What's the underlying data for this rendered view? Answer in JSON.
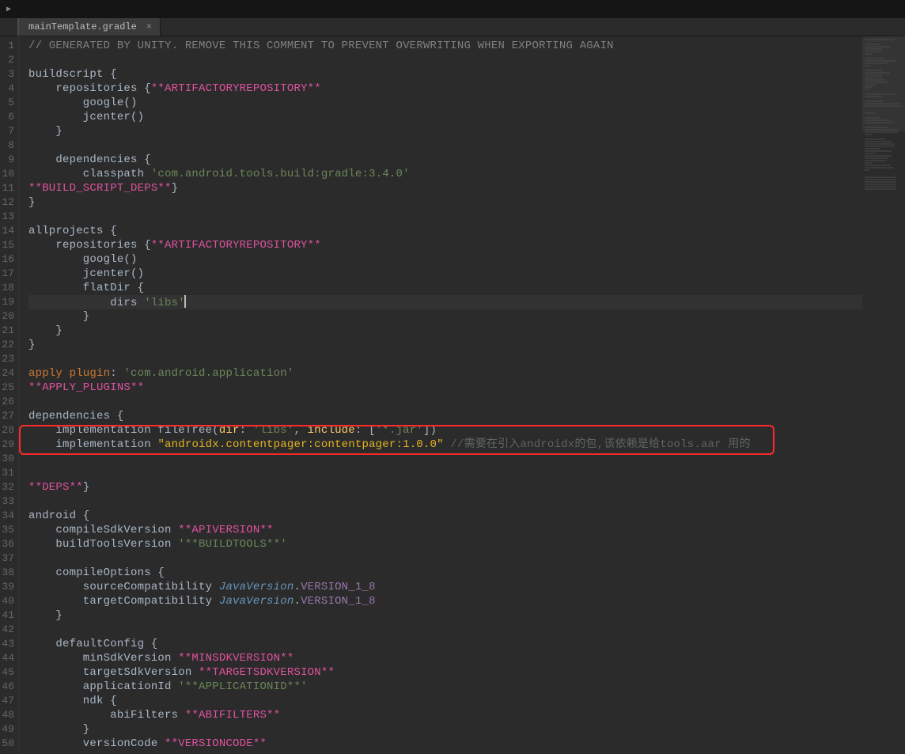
{
  "tab": {
    "filename": "mainTemplate.gradle",
    "close_glyph": "×"
  },
  "titlebar": {
    "play_glyph": "▶"
  },
  "gutter": {
    "start": 1,
    "end": 50
  },
  "code": {
    "l1": {
      "a": "// GENERATED BY UNITY. REMOVE THIS COMMENT TO PREVENT OVERWRITING WHEN EXPORTING AGAIN"
    },
    "l3": {
      "a": "buildscript",
      "b": " {"
    },
    "l4": {
      "a": "    repositories",
      "b": " {",
      "c": "**ARTIFACTORYREPOSITORY**"
    },
    "l5": {
      "a": "        google",
      "b": "()"
    },
    "l6": {
      "a": "        jcenter",
      "b": "()"
    },
    "l7": {
      "a": "    }"
    },
    "l9": {
      "a": "    dependencies",
      "b": " {"
    },
    "l10": {
      "a": "        classpath ",
      "b": "'com.android.tools.build:gradle:3.4.0'"
    },
    "l11": {
      "a": "**BUILD_SCRIPT_DEPS**",
      "b": "}"
    },
    "l12": {
      "a": "}"
    },
    "l14": {
      "a": "allprojects",
      "b": " {"
    },
    "l15": {
      "a": "    repositories",
      "b": " {",
      "c": "**ARTIFACTORYREPOSITORY**"
    },
    "l16": {
      "a": "        google",
      "b": "()"
    },
    "l17": {
      "a": "        jcenter",
      "b": "()"
    },
    "l18": {
      "a": "        flatDir",
      "b": " {"
    },
    "l19": {
      "a": "            dirs ",
      "b": "'libs'"
    },
    "l20": {
      "a": "        }"
    },
    "l21": {
      "a": "    }"
    },
    "l22": {
      "a": "}"
    },
    "l24": {
      "a": "apply",
      "b": " plugin",
      "c": ": ",
      "d": "'com.android.application'"
    },
    "l25": {
      "a": "**APPLY_PLUGINS**"
    },
    "l27": {
      "a": "dependencies",
      "b": " {"
    },
    "l28": {
      "a": "    implementation fileTree(",
      "b": "dir",
      "c": ": ",
      "d": "'libs'",
      "e": ", ",
      "f": "include",
      "g": ": [",
      "h": "'*.jar'",
      "i": "])"
    },
    "l29": {
      "a": "    implementation ",
      "b": "\"androidx.contentpager:contentpager:1.0.0\"",
      "c": " //需要在引入androidx的包,该依赖是给tools.aar 用的"
    },
    "l32": {
      "a": "**DEPS**",
      "b": "}"
    },
    "l34": {
      "a": "android",
      "b": " {"
    },
    "l35": {
      "a": "    compileSdkVersion ",
      "b": "**APIVERSION**"
    },
    "l36": {
      "a": "    buildToolsVersion ",
      "b": "'**BUILDTOOLS**'"
    },
    "l38": {
      "a": "    compileOptions",
      "b": " {"
    },
    "l39": {
      "a": "        sourceCompatibility ",
      "b": "JavaVersion",
      "c": ".",
      "d": "VERSION_1_8"
    },
    "l40": {
      "a": "        targetCompatibility ",
      "b": "JavaVersion",
      "c": ".",
      "d": "VERSION_1_8"
    },
    "l41": {
      "a": "    }"
    },
    "l43": {
      "a": "    defaultConfig",
      "b": " {"
    },
    "l44": {
      "a": "        minSdkVersion ",
      "b": "**MINSDKVERSION**"
    },
    "l45": {
      "a": "        targetSdkVersion ",
      "b": "**TARGETSDKVERSION**"
    },
    "l46": {
      "a": "        applicationId ",
      "b": "'**APPLICATIONID**'"
    },
    "l47": {
      "a": "        ndk",
      "b": " {"
    },
    "l48": {
      "a": "            abiFilters ",
      "b": "**ABIFILTERS**"
    },
    "l49": {
      "a": "        }"
    },
    "l50": {
      "a": "        versionCode ",
      "b": "**VERSIONCODE**"
    }
  }
}
